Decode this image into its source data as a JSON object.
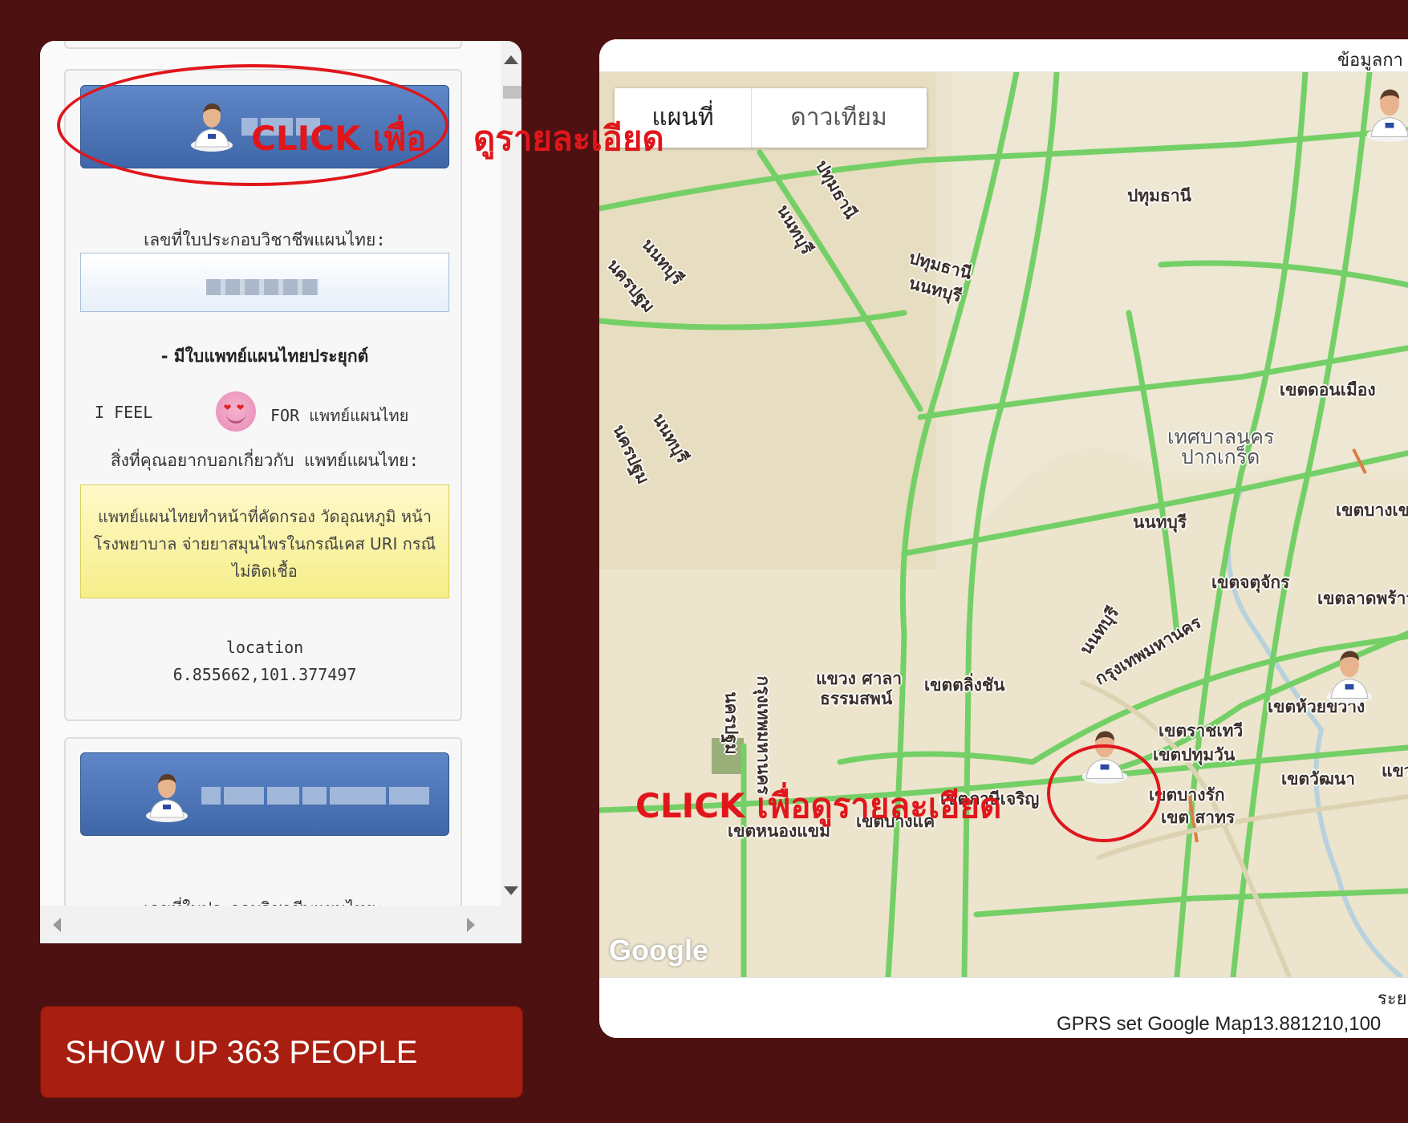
{
  "left_panel": {
    "card1": {
      "license_label": "เลขที่ใบประกอบวิชาชีพแผนไทย:",
      "badge": "-  มีใบแพทย์แผนไทยประยุกต์",
      "feel_left": "I FEEL",
      "feel_right": "FOR แพทย์แผนไทย",
      "about_label": "สิ่งที่คุณอยากบอกเกี่ยวกับ แพทย์แผนไทย:",
      "about_text": "แพทย์แผนไทยทำหน้าที่คัดกรอง วัดอุณหภูมิ หน้าโรงพยาบาล จ่ายยาสมุนไพรในกรณีเคส URI กรณีไม่ติดเชื้อ",
      "location_label": "location",
      "location_value": "6.855662,101.377497"
    },
    "card2": {
      "license_label": "เลขที่ใบประกอบวิชาชีพแผนไทย:"
    }
  },
  "show_up_button": "SHOW UP 363 PEOPLE",
  "map": {
    "header_text": "ข้อมูลกา",
    "map_type_options": [
      "แผนที่",
      "ดาวเทียม"
    ],
    "google_logo": "Google",
    "scale_text": "ระย",
    "gprs_text": "GPRS set Google Map13.881210,100",
    "labels": [
      "ปทุมธานี",
      "ปทุมธานี",
      "นนทบุรี",
      "นนทบุรี",
      "นครปฐม",
      "ปทุมธานี",
      "นนทบุรี",
      "นนทบุรี",
      "นครปฐม",
      "เขตดอนเมือง",
      "เทศบาลนคร",
      "ปากเกร็ด",
      "นนทบุรี",
      "เขตบางเข",
      "เขตจตุจักร",
      "เขตลาดพร้าว",
      "นนทบุรี",
      "กรุงเทพมหานคร",
      "แขวง ศาลา",
      "ธรรมสพน์",
      "เขตตลิ่งชัน",
      "กรุงเทพมหานคร",
      "นครปฐม",
      "เขตห้วยขวาง",
      "เขตราชเทวี",
      "เขตปทุมวัน",
      "เขตภาษีเจริญ",
      "เขตบางรัก",
      "เขต สาทร",
      "เขตวัฒนา",
      "แขว",
      "เขตหนองแขม",
      "เขตบางแค"
    ]
  },
  "annotations": {
    "top_click": "CLICK เพื่อ",
    "top_detail": "ดูรายละเอียด",
    "map_click": "CLICK เพื่อดูรายละเอียด",
    "color": "#e0161b"
  }
}
